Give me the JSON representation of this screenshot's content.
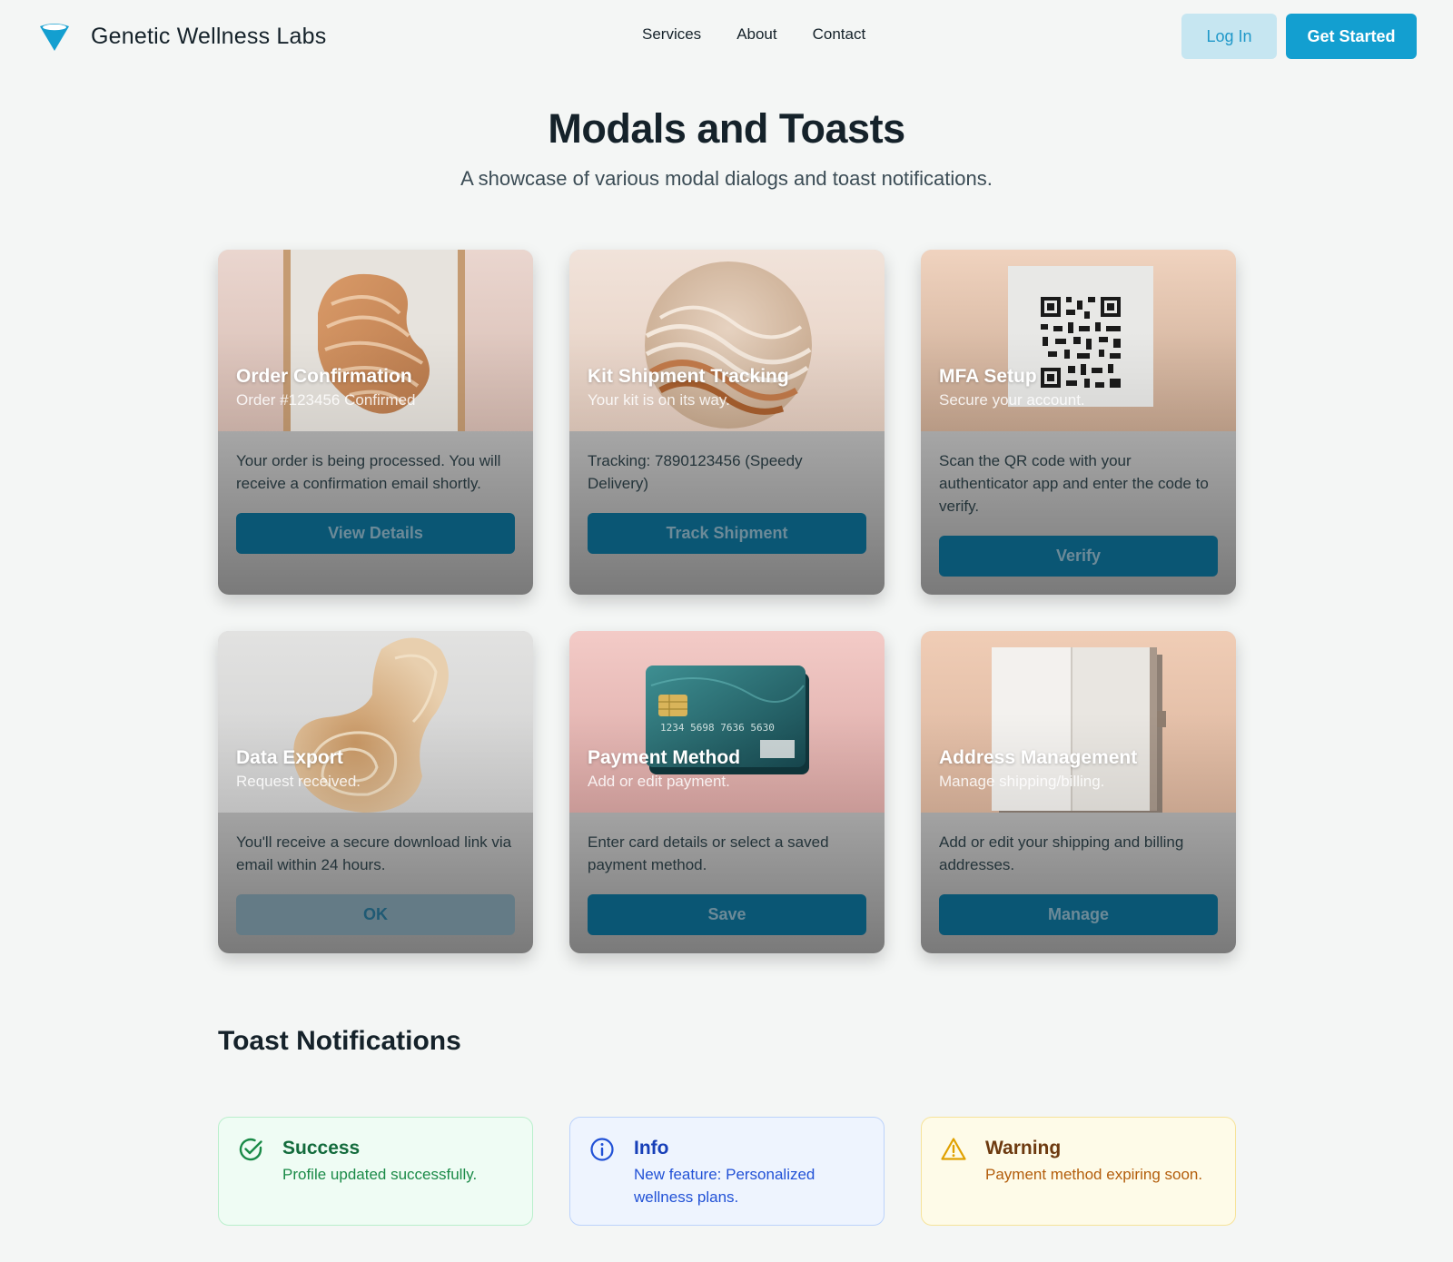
{
  "header": {
    "brand": "Genetic Wellness Labs",
    "nav": [
      "Services",
      "About",
      "Contact"
    ],
    "login_label": "Log In",
    "get_started_label": "Get Started"
  },
  "page": {
    "title": "Modals and Toasts",
    "subtitle": "A showcase of various modal dialogs and toast notifications."
  },
  "cards": [
    {
      "title": "Order Confirmation",
      "subtitle": "Order #123456 Confirmed",
      "text": "Your order is being processed. You will receive a confirmation email shortly.",
      "button": "View Details",
      "image": "framed-marble-swirl-art"
    },
    {
      "title": "Kit Shipment Tracking",
      "subtitle": "Your kit is on its way.",
      "text": "Tracking: 7890123456 (Speedy Delivery)",
      "button": "Track Shipment",
      "image": "circular-wave-relief"
    },
    {
      "title": "MFA Setup",
      "subtitle": "Secure your account.",
      "text": "Scan the QR code with your authenticator app and enter the code to verify.",
      "button": "Verify",
      "image": "qr-code-card"
    },
    {
      "title": "Data Export",
      "subtitle": "Request received.",
      "text": "You'll receive a secure download link via email within 24 hours.",
      "button": "OK",
      "image": "wood-grain-sculpture"
    },
    {
      "title": "Payment Method",
      "subtitle": "Add or edit payment.",
      "text": "Enter card details or select a saved payment method.",
      "button": "Save",
      "image": "credit-card",
      "card_number": "1234  5698  7636  5630"
    },
    {
      "title": "Address Management",
      "subtitle": "Manage shipping/billing.",
      "text": "Add or edit your shipping and billing addresses.",
      "button": "Manage",
      "image": "open-notebook"
    }
  ],
  "toasts_section": {
    "title": "Toast Notifications",
    "items": [
      {
        "type": "success",
        "icon": "check-circle-icon",
        "title": "Success",
        "message": "Profile updated successfully."
      },
      {
        "type": "info",
        "icon": "info-circle-icon",
        "title": "Info",
        "message": "New feature: Personalized wellness plans."
      },
      {
        "type": "warning",
        "icon": "warning-triangle-icon",
        "title": "Warning",
        "message": "Payment method expiring soon."
      }
    ]
  },
  "colors": {
    "brand": "#139fd0",
    "button_dark": "#0a5674",
    "success": "#1a8a47",
    "info": "#2151d6",
    "warning": "#b35d0b"
  }
}
